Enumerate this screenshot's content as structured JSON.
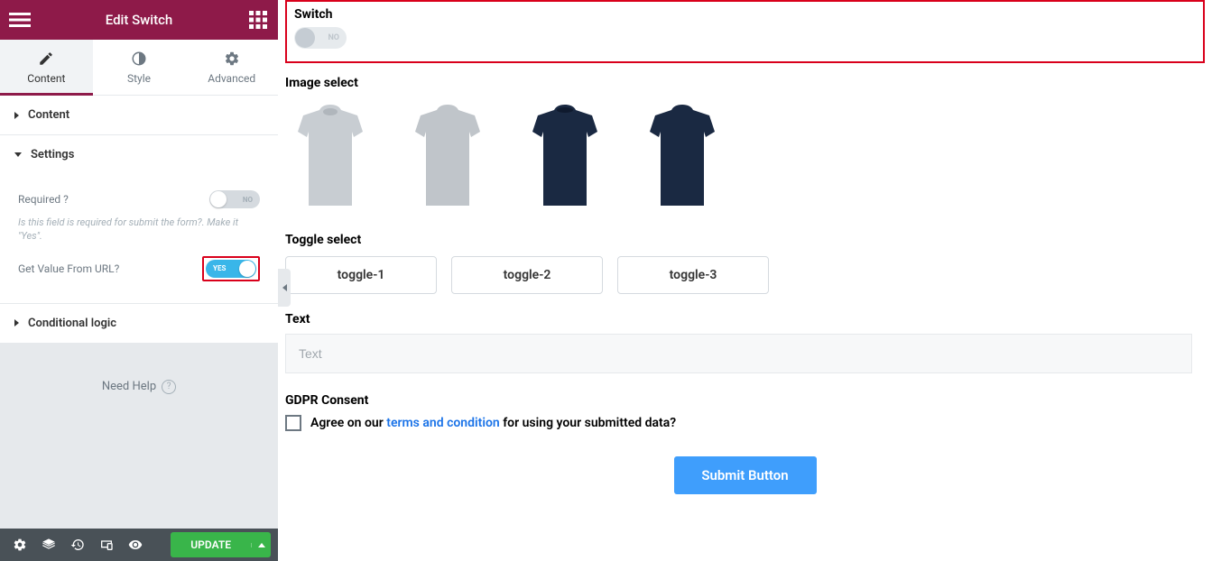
{
  "sidebar": {
    "title": "Edit Switch",
    "tabs": {
      "content": "Content",
      "style": "Style",
      "advanced": "Advanced",
      "active": "content"
    },
    "accordion": {
      "content_label": "Content",
      "settings_label": "Settings",
      "conditional_label": "Conditional logic"
    },
    "settings": {
      "required_label": "Required ?",
      "required_value": "NO",
      "required_desc": "Is this field is required for submit the form?. Make it \"Yes\".",
      "url_label": "Get Value From URL?",
      "url_value": "YES"
    },
    "need_help": "Need Help",
    "footer": {
      "update_label": "UPDATE"
    }
  },
  "main": {
    "switch": {
      "label": "Switch",
      "value": "NO"
    },
    "image_select": {
      "label": "Image select"
    },
    "toggle_select": {
      "label": "Toggle select",
      "options": [
        "toggle-1",
        "toggle-2",
        "toggle-3"
      ]
    },
    "text": {
      "label": "Text",
      "placeholder": "Text"
    },
    "gdpr": {
      "label": "GDPR Consent",
      "text_before": "Agree on our ",
      "link": "terms and condition",
      "text_after": " for using your submitted data?"
    },
    "submit": "Submit Button"
  }
}
